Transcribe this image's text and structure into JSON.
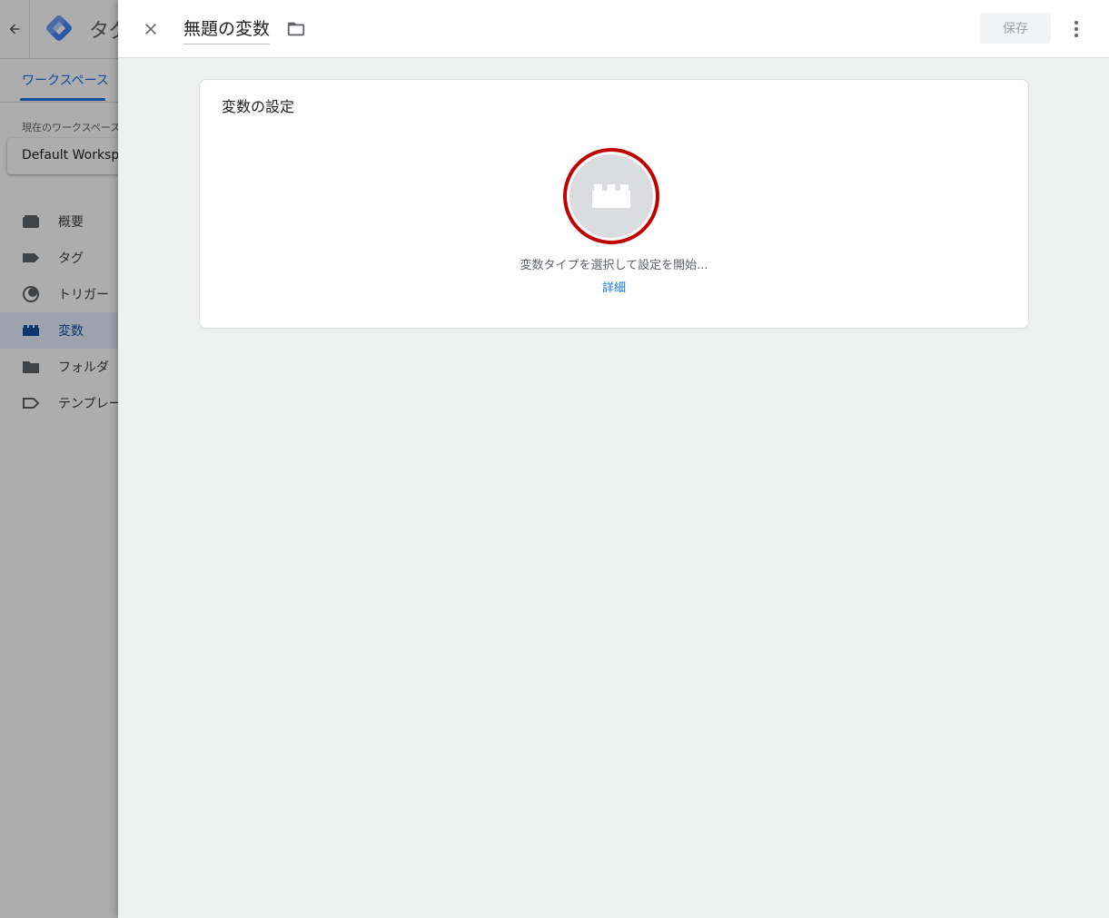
{
  "background_app": {
    "app_title": "タグ",
    "tab": "ワークスペース",
    "workspace_label": "現在のワークスペース",
    "workspace_name": "Default Workspace",
    "nav": [
      {
        "label": "概要",
        "icon": "overview-icon"
      },
      {
        "label": "タグ",
        "icon": "tag-icon"
      },
      {
        "label": "トリガー",
        "icon": "trigger-icon"
      },
      {
        "label": "変数",
        "icon": "variable-icon",
        "active": true
      },
      {
        "label": "フォルダ",
        "icon": "folder-icon"
      },
      {
        "label": "テンプレート",
        "icon": "template-icon"
      }
    ]
  },
  "panel": {
    "title": "無題の変数",
    "save_label": "保存",
    "card": {
      "title": "変数の設定",
      "hint": "変数タイプを選択して設定を開始...",
      "link": "詳細"
    }
  },
  "colors": {
    "accent": "#1a73e8",
    "highlight_ring": "#c00000",
    "panel_bg": "#eff1f1"
  }
}
